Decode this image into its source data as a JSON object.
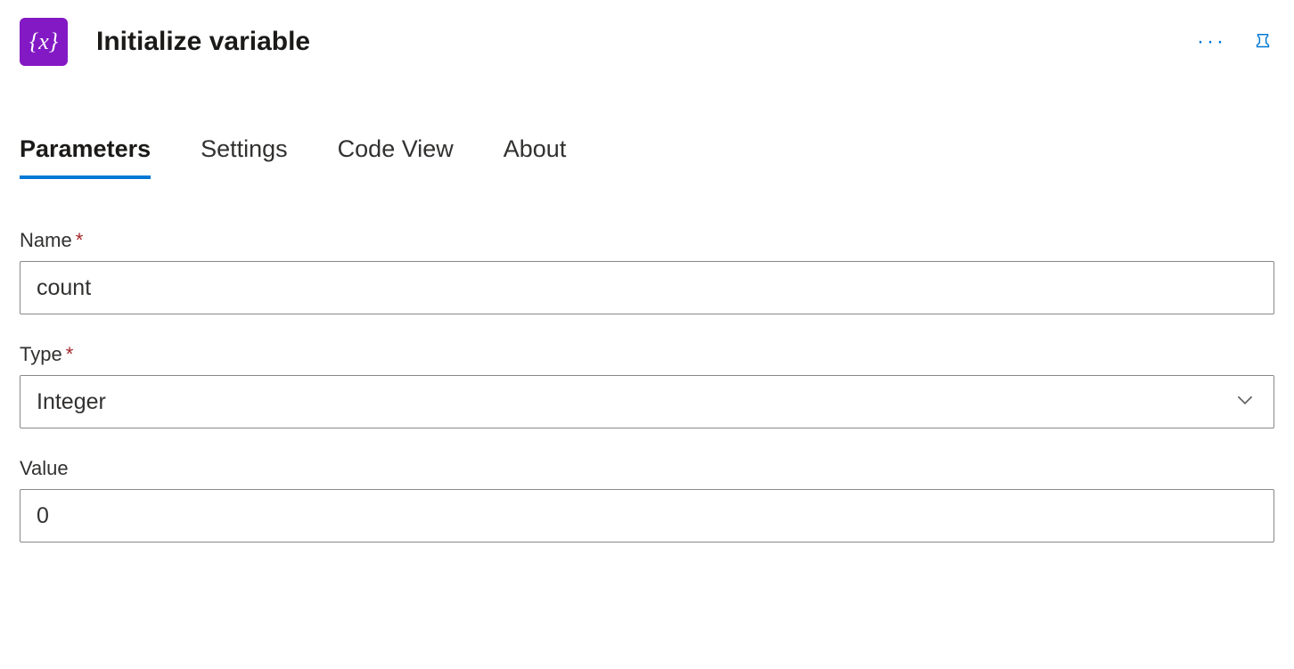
{
  "header": {
    "icon_label": "{x}",
    "title": "Initialize variable"
  },
  "tabs": {
    "parameters": "Parameters",
    "settings": "Settings",
    "code_view": "Code View",
    "about": "About",
    "active": "parameters"
  },
  "fields": {
    "name": {
      "label": "Name",
      "required_mark": "*",
      "value": "count"
    },
    "type": {
      "label": "Type",
      "required_mark": "*",
      "value": "Integer"
    },
    "value": {
      "label": "Value",
      "value": "0"
    }
  }
}
